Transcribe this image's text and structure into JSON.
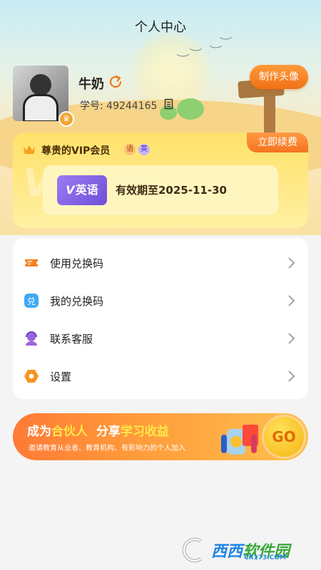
{
  "header": {
    "title": "个人中心"
  },
  "profile": {
    "username": "牛奶",
    "student_id_label": "学号:",
    "student_id": "49244165",
    "make_avatar_label": "制作头像"
  },
  "vip": {
    "title": "尊贵的VIP会员",
    "tags": [
      "语",
      "英"
    ],
    "renew_label": "立即续费",
    "course_badge": {
      "prefix": "V",
      "label": "英语"
    },
    "validity": "有效期至2025-11-30"
  },
  "menu": {
    "items": [
      {
        "label": "使用兑换码",
        "icon": "ticket-icon"
      },
      {
        "label": "我的兑换码",
        "icon": "redeem-code-icon"
      },
      {
        "label": "联系客服",
        "icon": "customer-service-icon"
      },
      {
        "label": "设置",
        "icon": "settings-icon"
      }
    ]
  },
  "partner": {
    "title_part1": "成为",
    "title_highlight1": "合伙人",
    "title_part2": "分享",
    "title_highlight2": "学习收益",
    "subtitle": "邀请教育从业者、教育机构、有影响力的个人加入",
    "go_label": "GO"
  },
  "watermark": {
    "brand_a": "西西",
    "brand_b": "软件园",
    "url": "CR173.COM"
  },
  "colors": {
    "accent": "#f5731e",
    "vip_gold": "#ffe26a",
    "purple": "#6f4fd8"
  }
}
